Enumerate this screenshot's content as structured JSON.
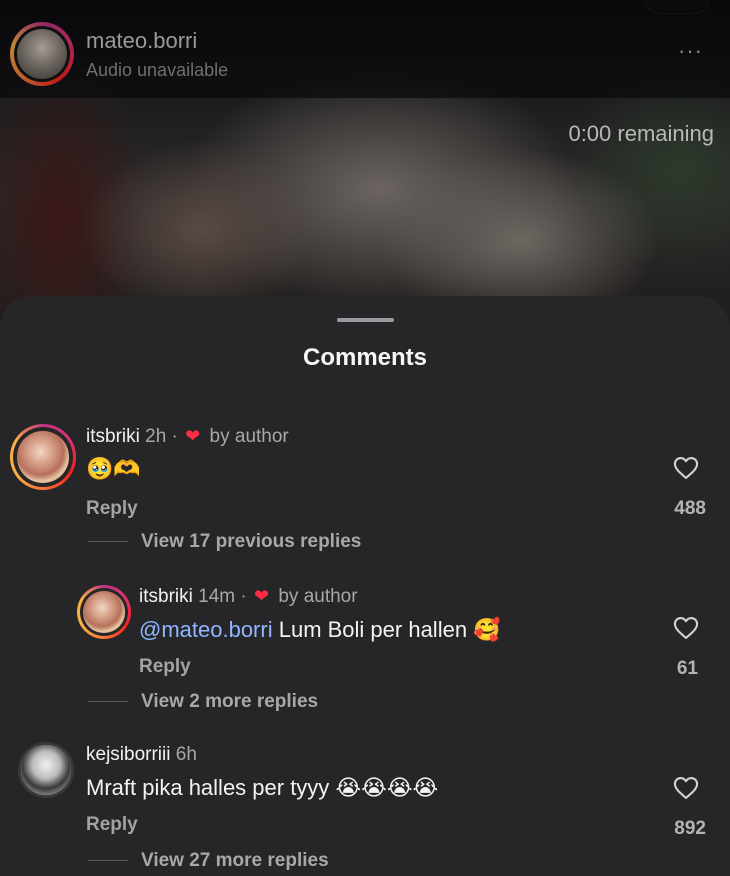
{
  "header": {
    "username": "mateo.borri",
    "subtitle": "Audio unavailable",
    "more": "···"
  },
  "video": {
    "remaining": "0:00 remaining"
  },
  "sheet": {
    "title": "Comments"
  },
  "comments": [
    {
      "username": "itsbriki",
      "time": "2h",
      "separator": "·",
      "badge": "by author",
      "text": "🥹🫶",
      "reply_label": "Reply",
      "likes": "488",
      "view_replies": "View 17 previous replies"
    },
    {
      "username": "itsbriki",
      "time": "14m",
      "separator": "·",
      "badge": "by author",
      "mention": "@mateo.borri",
      "text": " Lum Boli per hallen ",
      "emoji": "🥰",
      "reply_label": "Reply",
      "likes": "61",
      "view_replies": "View 2 more replies"
    },
    {
      "username": "kejsiborriii",
      "time": "6h",
      "text": "Mraft pika halles per tyyy ",
      "emoji": "😭😭😭😭",
      "reply_label": "Reply",
      "likes": "892",
      "view_replies": "View 27 more replies"
    }
  ],
  "icons": {
    "heart_outline": "heart-outline-icon",
    "heart_filled": "heart-filled-icon",
    "more": "more-icon"
  },
  "colors": {
    "sheet_bg": "#262628",
    "mention": "#8fb6ff",
    "author_heart": "#ff2d44"
  }
}
